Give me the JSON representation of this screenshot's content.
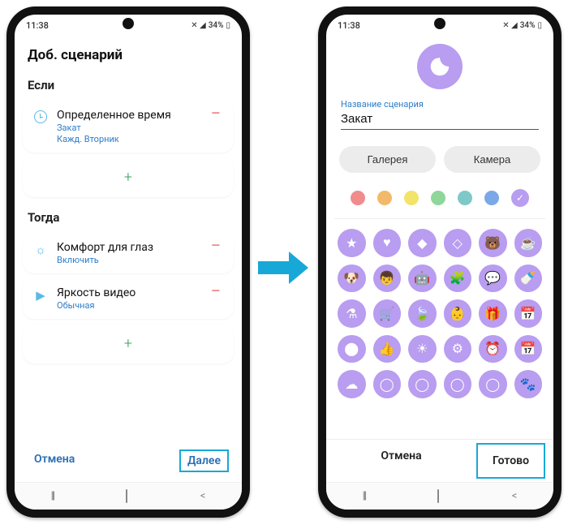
{
  "statusbar": {
    "time": "11:38",
    "battery": "34%",
    "signal_icons": "✕ ◢ ▯"
  },
  "left": {
    "title": "Доб. сценарий",
    "if_label": "Если",
    "then_label": "Тогда",
    "conditions": [
      {
        "title": "Определенное время",
        "sub1": "Закат",
        "sub2": "Кажд. Вторник"
      }
    ],
    "actions": [
      {
        "title": "Комфорт для глаз",
        "sub": "Включить"
      },
      {
        "title": "Яркость видео",
        "sub": "Обычная"
      }
    ],
    "cancel": "Отмена",
    "next": "Далее"
  },
  "right": {
    "field_label": "Название сценария",
    "field_value": "Закат",
    "tab_gallery": "Галерея",
    "tab_camera": "Камера",
    "colors": [
      "#f08c8c",
      "#f2b96b",
      "#f2e36b",
      "#8fd69a",
      "#7ec8c8",
      "#7ba8e8",
      "#b99df0"
    ],
    "selected_color_index": 6,
    "icons": [
      "★",
      "♥",
      "◆",
      "◇",
      "🐻",
      "☕",
      "🐶",
      "👦",
      "🤖",
      "🧩",
      "💬",
      "🍼",
      "⚗",
      "🛒",
      "🍃",
      "👶",
      "🎁",
      "📅",
      "⬤",
      "👍",
      "☀",
      "⚙",
      "⏰",
      "📅",
      "☁",
      "◯",
      "◯",
      "◯",
      "◯",
      "🐾"
    ],
    "cancel": "Отмена",
    "done": "Готово"
  }
}
